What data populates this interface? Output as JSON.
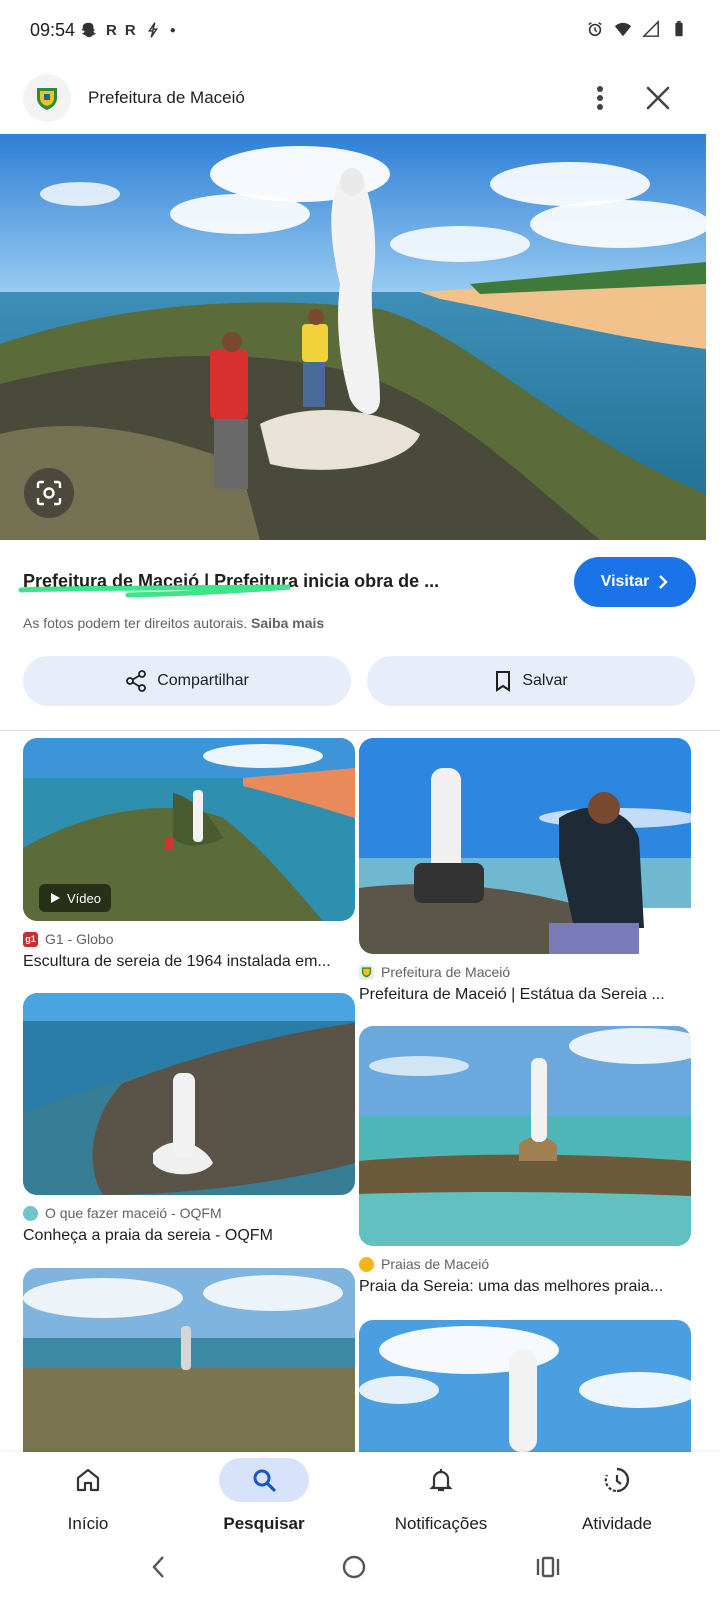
{
  "status_bar": {
    "time": "09:54",
    "left_icons": [
      "snapchat-icon",
      "r-icon",
      "r-icon",
      "bolt-icon",
      "dot-icon"
    ],
    "right_icons": [
      "alarm-icon",
      "wifi-icon",
      "signal-icon",
      "battery-icon"
    ]
  },
  "header": {
    "site_name": "Prefeitura de Maceió"
  },
  "result": {
    "title": "Prefeitura de Maceió | Prefeitura inicia obra de ...",
    "visit_label": "Visitar",
    "rights_note": "As fotos podem ter direitos autorais.",
    "learn_more": "Saiba mais"
  },
  "actions": {
    "share_label": "Compartilhar",
    "save_label": "Salvar"
  },
  "grid": {
    "left": [
      {
        "source": "G1 - Globo",
        "title": "Escultura de sereia de 1964 instalada em...",
        "badge": "Vídeo",
        "icon_color": "#c4302b",
        "icon_text": "g1"
      },
      {
        "source": "O que fazer maceió - OQFM",
        "title": "Conheça a praia da sereia - OQFM",
        "icon_color": "#6fc4c9",
        "icon_text": ""
      },
      {
        "source": "",
        "title": ""
      }
    ],
    "right": [
      {
        "source": "Prefeitura de Maceió",
        "title": "Prefeitura de Maceió | Estátua da Sereia ...",
        "icon_color": "#7aa65a",
        "icon_text": ""
      },
      {
        "source": "Praias de Maceió",
        "title": "Praia da Sereia: uma das melhores praia...",
        "icon_color": "#f5b41a",
        "icon_text": ""
      },
      {
        "source": "",
        "title": ""
      }
    ]
  },
  "bottom_nav": {
    "items": [
      {
        "label": "Início",
        "icon": "home-icon"
      },
      {
        "label": "Pesquisar",
        "icon": "search-icon",
        "active": true
      },
      {
        "label": "Notificações",
        "icon": "bell-icon"
      },
      {
        "label": "Atividade",
        "icon": "activity-icon"
      }
    ]
  },
  "colors": {
    "accent": "#1a73e8",
    "chip_bg": "#e8eef9",
    "active_nav_bg": "#d6e3fb",
    "highlight": "#3ee38a"
  }
}
